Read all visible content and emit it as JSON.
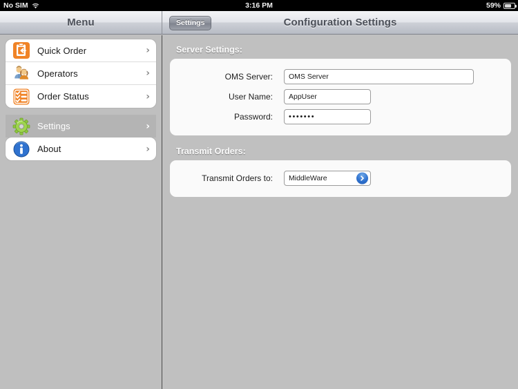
{
  "status_bar": {
    "carrier": "No SIM",
    "wifi_icon": "wifi-icon",
    "time": "3:16 PM",
    "battery_percent": "59%",
    "battery_icon": "battery-icon"
  },
  "master_pane": {
    "title": "Menu",
    "groups": [
      {
        "items": [
          {
            "label": "Quick Order",
            "icon": "clipboard-arrow-icon",
            "chevron": "›",
            "selected": false
          },
          {
            "label": "Operators",
            "icon": "two-people-icon",
            "chevron": "›",
            "selected": false
          },
          {
            "label": "Order Status",
            "icon": "checklist-icon",
            "chevron": "›",
            "selected": false
          }
        ]
      },
      {
        "items": [
          {
            "label": "Settings",
            "icon": "green-gear-icon",
            "chevron": "›",
            "selected": true
          }
        ]
      },
      {
        "items": [
          {
            "label": "About",
            "icon": "blue-info-icon",
            "chevron": "›",
            "selected": false
          }
        ]
      }
    ]
  },
  "detail_pane": {
    "back_button": "Settings",
    "title": "Configuration Settings",
    "sections": [
      {
        "heading": "Server Settings:",
        "fields": [
          {
            "label": "OMS Server:",
            "value": "OMS Server",
            "type": "text",
            "width": "wide"
          },
          {
            "label": "User Name:",
            "value": "AppUser",
            "type": "text",
            "width": "med"
          },
          {
            "label": "Password:",
            "value": "•••••••",
            "type": "password",
            "width": "med"
          }
        ]
      },
      {
        "heading": "Transmit Orders:",
        "fields": [
          {
            "label": "Transmit Orders to:",
            "value": "MiddleWare",
            "type": "select",
            "width": "sel",
            "disclosure_icon": "chevron-right-circle-icon"
          }
        ]
      }
    ]
  },
  "colors": {
    "pane_background": "#c0c0c0",
    "card_background": "#fafafa",
    "accent_orange": "#f08326",
    "accent_blue": "#2f72cf",
    "accent_green": "#8cc63f",
    "selected_row": "#b4b4b4"
  }
}
